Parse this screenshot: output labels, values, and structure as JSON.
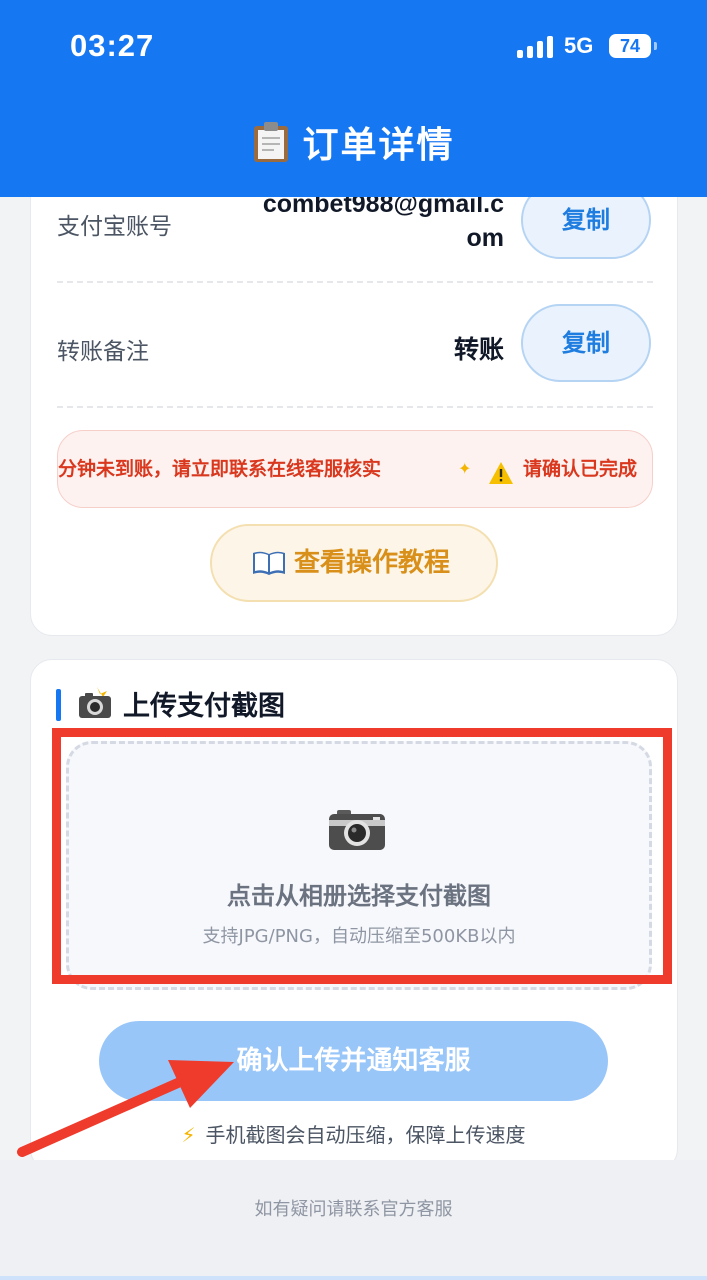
{
  "status_bar": {
    "time": "03:27",
    "network": "5G",
    "battery": "74"
  },
  "header": {
    "title": "订单详情",
    "clipboard_icon": "clipboard-icon"
  },
  "account": {
    "label": "支付宝账号",
    "value_line1": "combet988@gmail.c",
    "value_line2": "om",
    "copy_label": "复制"
  },
  "remark": {
    "label": "转账备注",
    "value": "转账",
    "copy_label": "复制"
  },
  "alert": {
    "text_left": "分钟未到账，请立即联系在线客服核实",
    "text_right": "请确认已完成",
    "icon": "warning-icon",
    "color": "#d9381e"
  },
  "tutorial": {
    "label": "查看操作教程",
    "icon": "book-icon"
  },
  "upload_section": {
    "title": "上传支付截图",
    "icon": "camera-flash-icon",
    "dropzone_main": "点击从相册选择支付截图",
    "dropzone_sub": "支持JPG/PNG，自动压缩至500KB以内",
    "highlight_color": "#ef3b2c"
  },
  "confirm_button": {
    "label": "确认上传并通知客服"
  },
  "tip": {
    "bolt": "⚡",
    "text": "手机截图会自动压缩，保障上传速度"
  },
  "footer": {
    "text": "如有疑问请联系官方客服"
  },
  "colors": {
    "primary": "#1677f2",
    "button_disabled": "#99c6f9",
    "annotation_red": "#ef3b2c"
  }
}
